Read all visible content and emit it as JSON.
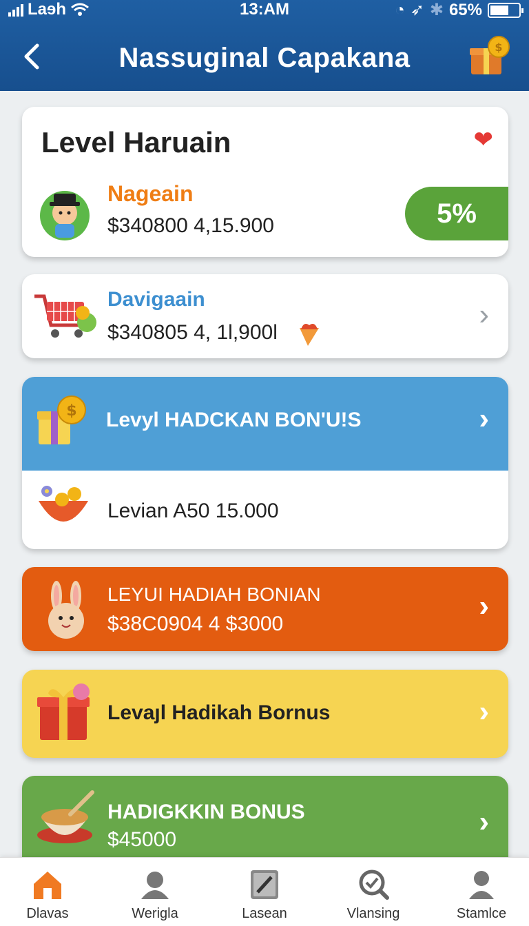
{
  "status_bar": {
    "carrier": "Laɘh",
    "time": "13:AM",
    "battery": "65%",
    "battery_level": 0.65
  },
  "header": {
    "back_icon": "chevron-left-icon",
    "title": "Nassuginal Capakana",
    "gift_icon": "gift-coin-icon"
  },
  "card1": {
    "heading": "Level Haruain",
    "heart_icon": "heart-icon",
    "name": "Nageain",
    "amount": "$340800 4,15.900",
    "percent": "5%"
  },
  "card2": {
    "name": "Davigaain",
    "amount": "$340805 4, 1l,900l"
  },
  "card3": {
    "header_label": "Levyl HADCKAN BON'U!S",
    "row_label": "Levian A50 15.000"
  },
  "card4": {
    "label": "LEYUI  HADIAH BONIAN",
    "amount": "$38C0904  4  $3000"
  },
  "card5": {
    "label": "Levaȷl Hadikah Bornus"
  },
  "card6": {
    "label": "HADIGKKIN BONUS",
    "amount": "$45000"
  },
  "nav": {
    "items": [
      {
        "label": "Dlavas",
        "icon": "home-icon"
      },
      {
        "label": "Weriglа",
        "icon": "user-icon"
      },
      {
        "label": "Lasean",
        "icon": "document-edit-icon"
      },
      {
        "label": "Vlansing",
        "icon": "search-icon"
      },
      {
        "label": "Stamlce",
        "icon": "person-icon"
      }
    ]
  },
  "colors": {
    "header": "#1f5fa3",
    "pct_pill": "#5aa33a",
    "blue_card": "#4f9fd6",
    "orange_card": "#e35c10",
    "yellow_card": "#f6d452",
    "green_card": "#68a84a"
  }
}
